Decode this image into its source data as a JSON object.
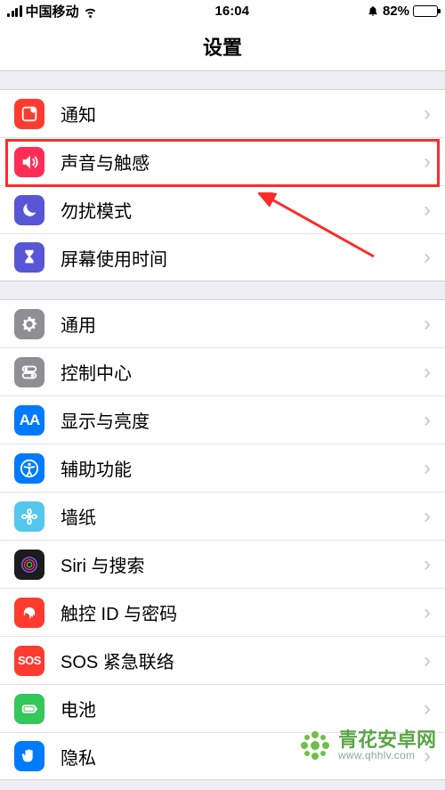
{
  "statusbar": {
    "carrier": "中国移动",
    "time": "16:04",
    "battery_pct": "82%"
  },
  "navbar": {
    "title": "设置"
  },
  "groups": [
    {
      "rows": [
        {
          "id": "notifications",
          "label": "通知",
          "icon_name": "notifications-icon",
          "bg": "#ff3b30"
        },
        {
          "id": "sounds",
          "label": "声音与触感",
          "icon_name": "sound-icon",
          "bg": "#ff2d55"
        },
        {
          "id": "dnd",
          "label": "勿扰模式",
          "icon_name": "moon-icon",
          "bg": "#5856d6"
        },
        {
          "id": "screentime",
          "label": "屏幕使用时间",
          "icon_name": "hourglass-icon",
          "bg": "#5856d6"
        }
      ]
    },
    {
      "rows": [
        {
          "id": "general",
          "label": "通用",
          "icon_name": "gear-icon",
          "bg": "#8e8e93"
        },
        {
          "id": "control",
          "label": "控制中心",
          "icon_name": "switches-icon",
          "bg": "#8e8e93"
        },
        {
          "id": "display",
          "label": "显示与亮度",
          "icon_name": "aa-icon",
          "bg": "#007aff"
        },
        {
          "id": "accessibility",
          "label": "辅助功能",
          "icon_name": "accessibility-icon",
          "bg": "#007aff"
        },
        {
          "id": "wallpaper",
          "label": "墙纸",
          "icon_name": "flower-icon",
          "bg": "#54c7ec"
        },
        {
          "id": "siri",
          "label": "Siri 与搜索",
          "icon_name": "siri-icon",
          "bg": "#1c1c1e"
        },
        {
          "id": "touchid",
          "label": "触控 ID 与密码",
          "icon_name": "fingerprint-icon",
          "bg": "#ff3b30"
        },
        {
          "id": "sos",
          "label": "SOS 紧急联络",
          "icon_name": "sos-icon",
          "bg": "#ff3b30"
        },
        {
          "id": "battery",
          "label": "电池",
          "icon_name": "battery-icon",
          "bg": "#34c759"
        },
        {
          "id": "privacy",
          "label": "隐私",
          "icon_name": "hand-icon",
          "bg": "#007aff"
        }
      ]
    }
  ],
  "watermark": {
    "brand": "青花安卓网",
    "url": "www.qhhlv.com"
  }
}
